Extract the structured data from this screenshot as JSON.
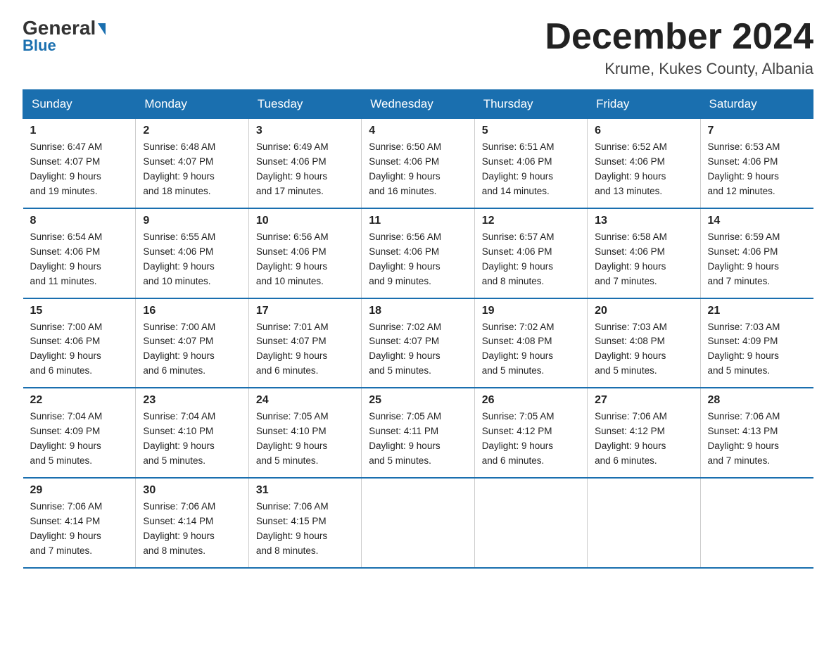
{
  "header": {
    "logo_general": "General",
    "logo_blue": "Blue",
    "month_title": "December 2024",
    "location": "Krume, Kukes County, Albania"
  },
  "days_of_week": [
    "Sunday",
    "Monday",
    "Tuesday",
    "Wednesday",
    "Thursday",
    "Friday",
    "Saturday"
  ],
  "weeks": [
    [
      {
        "day": "1",
        "sunrise": "6:47 AM",
        "sunset": "4:07 PM",
        "daylight": "9 hours and 19 minutes."
      },
      {
        "day": "2",
        "sunrise": "6:48 AM",
        "sunset": "4:07 PM",
        "daylight": "9 hours and 18 minutes."
      },
      {
        "day": "3",
        "sunrise": "6:49 AM",
        "sunset": "4:06 PM",
        "daylight": "9 hours and 17 minutes."
      },
      {
        "day": "4",
        "sunrise": "6:50 AM",
        "sunset": "4:06 PM",
        "daylight": "9 hours and 16 minutes."
      },
      {
        "day": "5",
        "sunrise": "6:51 AM",
        "sunset": "4:06 PM",
        "daylight": "9 hours and 14 minutes."
      },
      {
        "day": "6",
        "sunrise": "6:52 AM",
        "sunset": "4:06 PM",
        "daylight": "9 hours and 13 minutes."
      },
      {
        "day": "7",
        "sunrise": "6:53 AM",
        "sunset": "4:06 PM",
        "daylight": "9 hours and 12 minutes."
      }
    ],
    [
      {
        "day": "8",
        "sunrise": "6:54 AM",
        "sunset": "4:06 PM",
        "daylight": "9 hours and 11 minutes."
      },
      {
        "day": "9",
        "sunrise": "6:55 AM",
        "sunset": "4:06 PM",
        "daylight": "9 hours and 10 minutes."
      },
      {
        "day": "10",
        "sunrise": "6:56 AM",
        "sunset": "4:06 PM",
        "daylight": "9 hours and 10 minutes."
      },
      {
        "day": "11",
        "sunrise": "6:56 AM",
        "sunset": "4:06 PM",
        "daylight": "9 hours and 9 minutes."
      },
      {
        "day": "12",
        "sunrise": "6:57 AM",
        "sunset": "4:06 PM",
        "daylight": "9 hours and 8 minutes."
      },
      {
        "day": "13",
        "sunrise": "6:58 AM",
        "sunset": "4:06 PM",
        "daylight": "9 hours and 7 minutes."
      },
      {
        "day": "14",
        "sunrise": "6:59 AM",
        "sunset": "4:06 PM",
        "daylight": "9 hours and 7 minutes."
      }
    ],
    [
      {
        "day": "15",
        "sunrise": "7:00 AM",
        "sunset": "4:06 PM",
        "daylight": "9 hours and 6 minutes."
      },
      {
        "day": "16",
        "sunrise": "7:00 AM",
        "sunset": "4:07 PM",
        "daylight": "9 hours and 6 minutes."
      },
      {
        "day": "17",
        "sunrise": "7:01 AM",
        "sunset": "4:07 PM",
        "daylight": "9 hours and 6 minutes."
      },
      {
        "day": "18",
        "sunrise": "7:02 AM",
        "sunset": "4:07 PM",
        "daylight": "9 hours and 5 minutes."
      },
      {
        "day": "19",
        "sunrise": "7:02 AM",
        "sunset": "4:08 PM",
        "daylight": "9 hours and 5 minutes."
      },
      {
        "day": "20",
        "sunrise": "7:03 AM",
        "sunset": "4:08 PM",
        "daylight": "9 hours and 5 minutes."
      },
      {
        "day": "21",
        "sunrise": "7:03 AM",
        "sunset": "4:09 PM",
        "daylight": "9 hours and 5 minutes."
      }
    ],
    [
      {
        "day": "22",
        "sunrise": "7:04 AM",
        "sunset": "4:09 PM",
        "daylight": "9 hours and 5 minutes."
      },
      {
        "day": "23",
        "sunrise": "7:04 AM",
        "sunset": "4:10 PM",
        "daylight": "9 hours and 5 minutes."
      },
      {
        "day": "24",
        "sunrise": "7:05 AM",
        "sunset": "4:10 PM",
        "daylight": "9 hours and 5 minutes."
      },
      {
        "day": "25",
        "sunrise": "7:05 AM",
        "sunset": "4:11 PM",
        "daylight": "9 hours and 5 minutes."
      },
      {
        "day": "26",
        "sunrise": "7:05 AM",
        "sunset": "4:12 PM",
        "daylight": "9 hours and 6 minutes."
      },
      {
        "day": "27",
        "sunrise": "7:06 AM",
        "sunset": "4:12 PM",
        "daylight": "9 hours and 6 minutes."
      },
      {
        "day": "28",
        "sunrise": "7:06 AM",
        "sunset": "4:13 PM",
        "daylight": "9 hours and 7 minutes."
      }
    ],
    [
      {
        "day": "29",
        "sunrise": "7:06 AM",
        "sunset": "4:14 PM",
        "daylight": "9 hours and 7 minutes."
      },
      {
        "day": "30",
        "sunrise": "7:06 AM",
        "sunset": "4:14 PM",
        "daylight": "9 hours and 8 minutes."
      },
      {
        "day": "31",
        "sunrise": "7:06 AM",
        "sunset": "4:15 PM",
        "daylight": "9 hours and 8 minutes."
      },
      null,
      null,
      null,
      null
    ]
  ],
  "labels": {
    "sunrise": "Sunrise:",
    "sunset": "Sunset:",
    "daylight": "Daylight:"
  }
}
